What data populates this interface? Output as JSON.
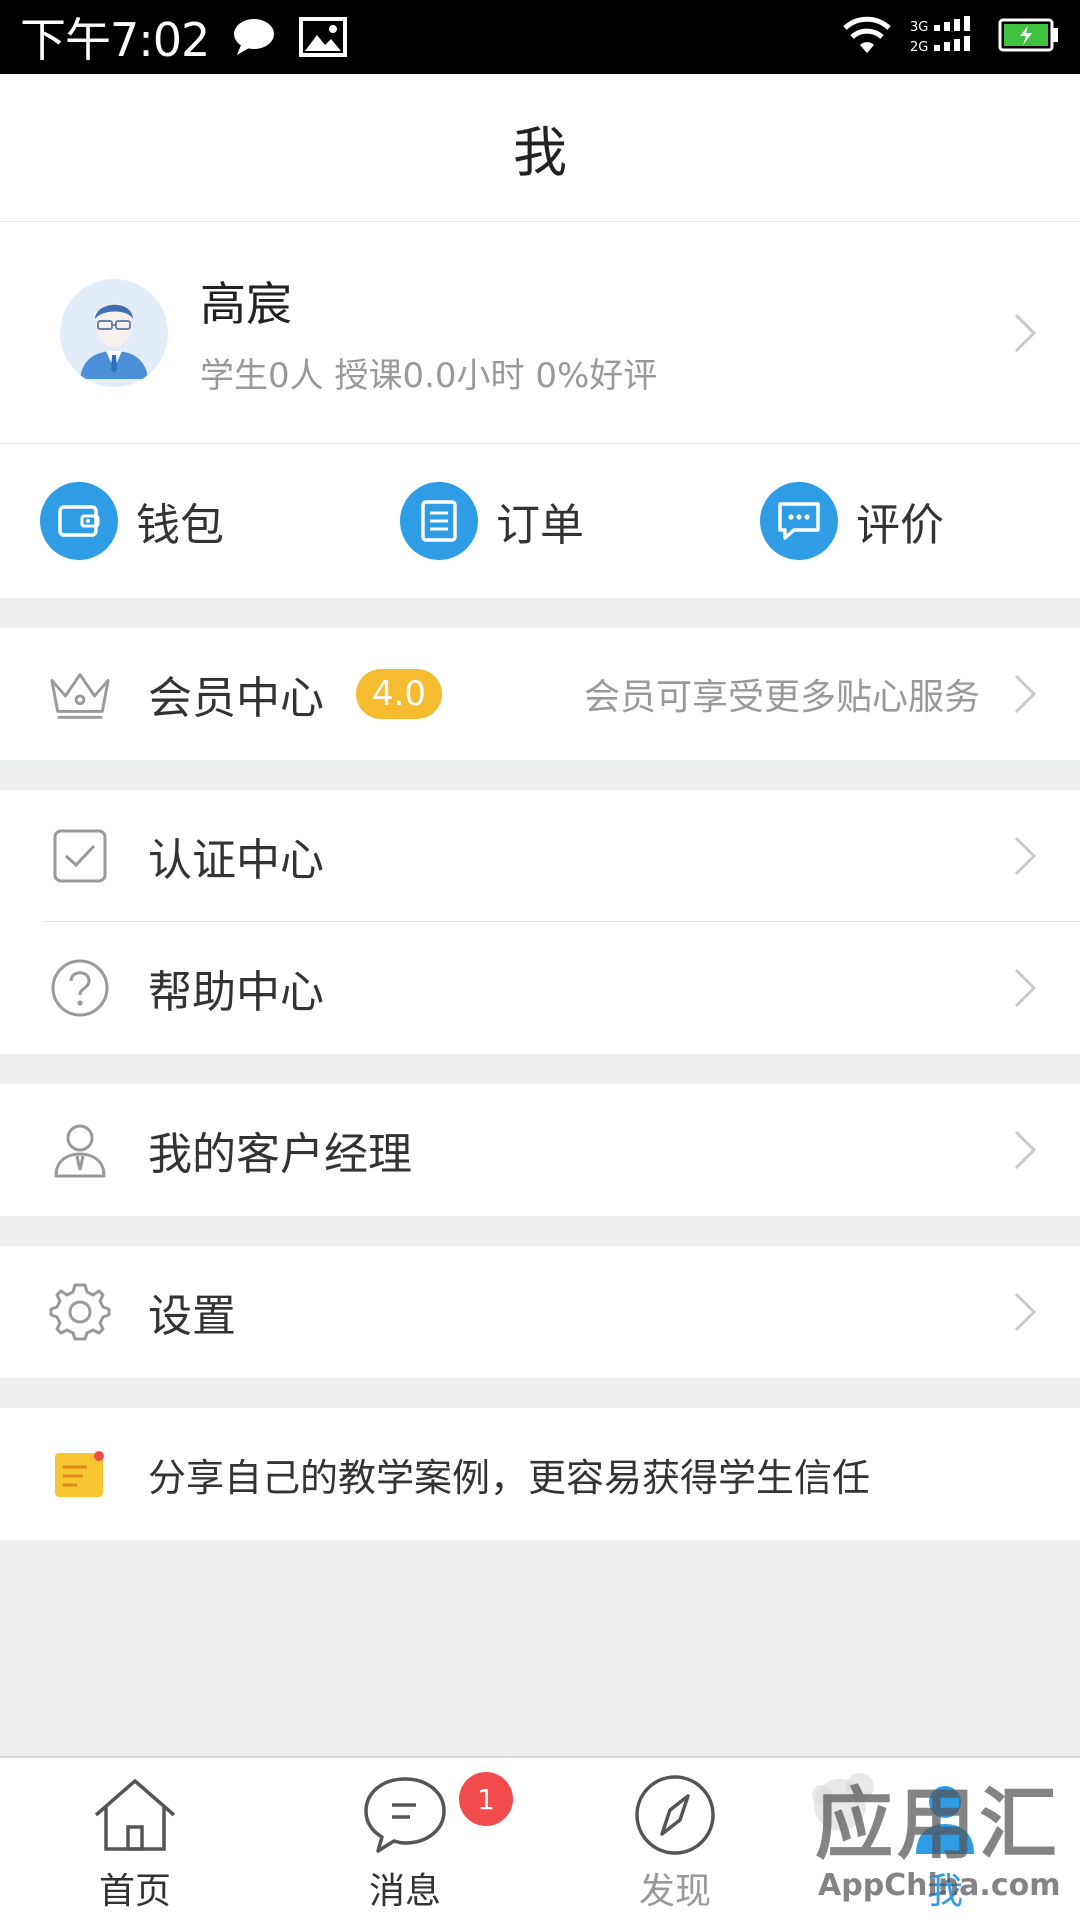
{
  "status_bar": {
    "time": "下午7:02",
    "network": "3G 2G"
  },
  "header": {
    "title": "我"
  },
  "profile": {
    "name": "高宸",
    "stats": "学生0人 授课0.0小时 0%好评"
  },
  "quick_actions": [
    {
      "label": "钱包",
      "icon": "wallet-icon"
    },
    {
      "label": "订单",
      "icon": "order-list-icon"
    },
    {
      "label": "评价",
      "icon": "comment-icon"
    }
  ],
  "menu": {
    "member": {
      "label": "会员中心",
      "badge": "4.0",
      "desc": "会员可享受更多贴心服务",
      "icon": "crown-icon"
    },
    "certification": {
      "label": "认证中心",
      "icon": "checkbox-icon"
    },
    "help": {
      "label": "帮助中心",
      "icon": "question-icon"
    },
    "account_manager": {
      "label": "我的客户经理",
      "icon": "manager-icon"
    },
    "settings": {
      "label": "设置",
      "icon": "gear-icon"
    },
    "share": {
      "label": "分享自己的教学案例，更容易获得学生信任",
      "icon": "note-icon"
    }
  },
  "tabs": [
    {
      "label": "首页",
      "icon": "home-icon"
    },
    {
      "label": "消息",
      "icon": "message-icon",
      "badge": "1"
    },
    {
      "label": "发现",
      "icon": "compass-icon"
    },
    {
      "label": "我",
      "icon": "person-icon",
      "active": true
    }
  ],
  "watermark": {
    "text": "应用汇",
    "sub": "AppChina.com"
  },
  "colors": {
    "accent": "#2e9de6",
    "badge": "#f6bc2f",
    "notification": "#f24b4b"
  }
}
